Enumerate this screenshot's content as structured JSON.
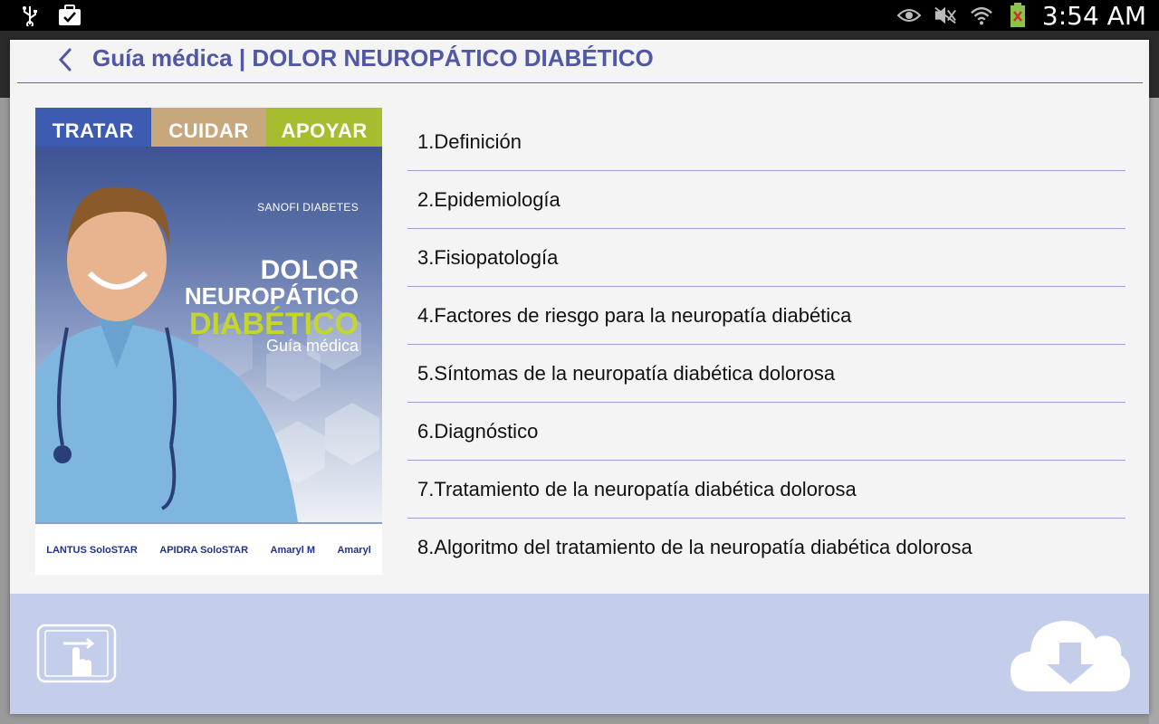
{
  "status_bar": {
    "clock": "3:54 AM",
    "icons": [
      "usb-icon",
      "briefcase-check-icon",
      "eye-icon",
      "mute-icon",
      "wifi-icon",
      "battery-icon"
    ]
  },
  "header": {
    "title": "Guía médica | DOLOR NEUROPÁTICO DIABÉTICO",
    "back_icon": "chevron-left-icon"
  },
  "cover": {
    "tabs": [
      "TRATAR",
      "CUIDAR",
      "APOYAR"
    ],
    "brand": "SANOFI DIABETES",
    "title_line1": "DOLOR",
    "title_line2": "NEUROPÁTICO",
    "title_line3": "DIABÉTICO",
    "subtitle": "Guía médica",
    "logos": [
      "LANTUS SoloSTAR",
      "APIDRA SoloSTAR",
      "Amaryl M",
      "Amaryl"
    ]
  },
  "toc": [
    "1.Definición",
    "2.Epidemiología",
    "3.Fisiopatología",
    "4.Factores de riesgo para la neuropatía diabética",
    "5.Síntomas de la neuropatía diabética dolorosa",
    "6.Diagnóstico",
    "7.Tratamiento de la neuropatía diabética dolorosa",
    "8.Algoritmo del tratamiento de la neuropatía diabética dolorosa"
  ],
  "footer": {
    "left_icon": "swipe-gesture-icon",
    "right_icon": "cloud-download-icon"
  },
  "colors": {
    "accent": "#5057a8",
    "footer": "#c4cdea",
    "tab_tratar": "#3d5bb0",
    "tab_cuidar": "#c7a87d",
    "tab_apoyar": "#a7bd2f"
  }
}
